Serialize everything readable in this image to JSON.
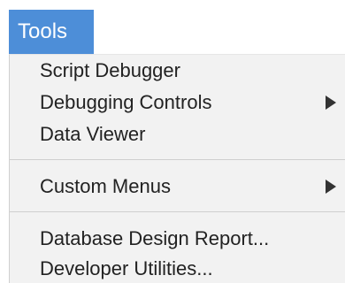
{
  "menu": {
    "title": "Tools",
    "groups": [
      {
        "items": [
          {
            "label": "Script Debugger",
            "has_submenu": false
          },
          {
            "label": "Debugging Controls",
            "has_submenu": true
          },
          {
            "label": "Data Viewer",
            "has_submenu": false
          }
        ]
      },
      {
        "items": [
          {
            "label": "Custom Menus",
            "has_submenu": true
          }
        ]
      },
      {
        "items": [
          {
            "label": "Database Design Report...",
            "has_submenu": false
          },
          {
            "label": "Developer Utilities...",
            "has_submenu": false
          }
        ]
      }
    ]
  },
  "icons": {
    "submenu": "chevron-right-icon"
  },
  "colors": {
    "title_background": "#4d8ed8",
    "title_text": "#ffffff",
    "menu_background": "#f2f2f2",
    "menu_text": "#222222",
    "separator": "#cfcfcf"
  }
}
